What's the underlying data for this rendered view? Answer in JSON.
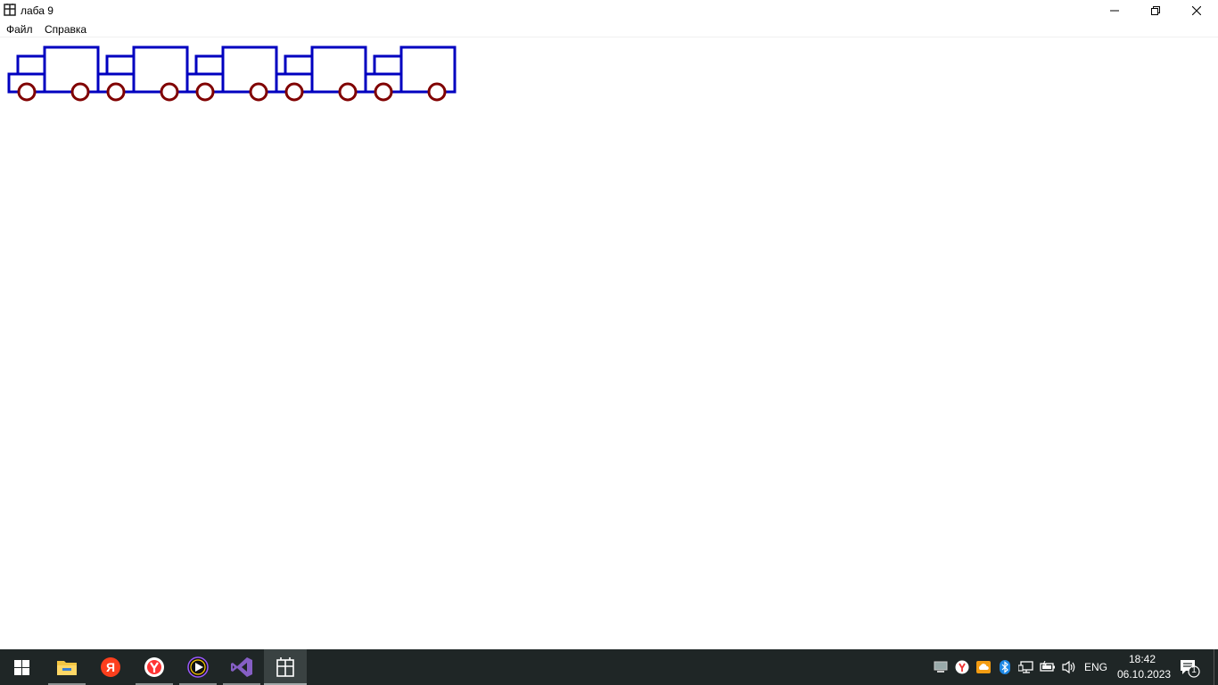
{
  "window": {
    "title": "лаба 9",
    "buttons": [
      "minimize",
      "restore",
      "close"
    ]
  },
  "menu": {
    "file": "Файл",
    "help": "Справка"
  },
  "canvas": {
    "truck_count": 5,
    "body_color": "#0000c0",
    "wheel_color": "#800000"
  },
  "taskbar": {
    "apps": [
      {
        "icon": "windows-start-icon"
      },
      {
        "icon": "file-explorer-icon"
      },
      {
        "icon": "yandex-icon"
      },
      {
        "icon": "yandex-browser-icon"
      },
      {
        "icon": "media-player-icon"
      },
      {
        "icon": "visual-studio-icon"
      },
      {
        "icon": "lab9-app-icon"
      }
    ],
    "tray": {
      "language": "ENG",
      "time": "18:42",
      "date": "06.10.2023",
      "notification_count": "1"
    }
  }
}
